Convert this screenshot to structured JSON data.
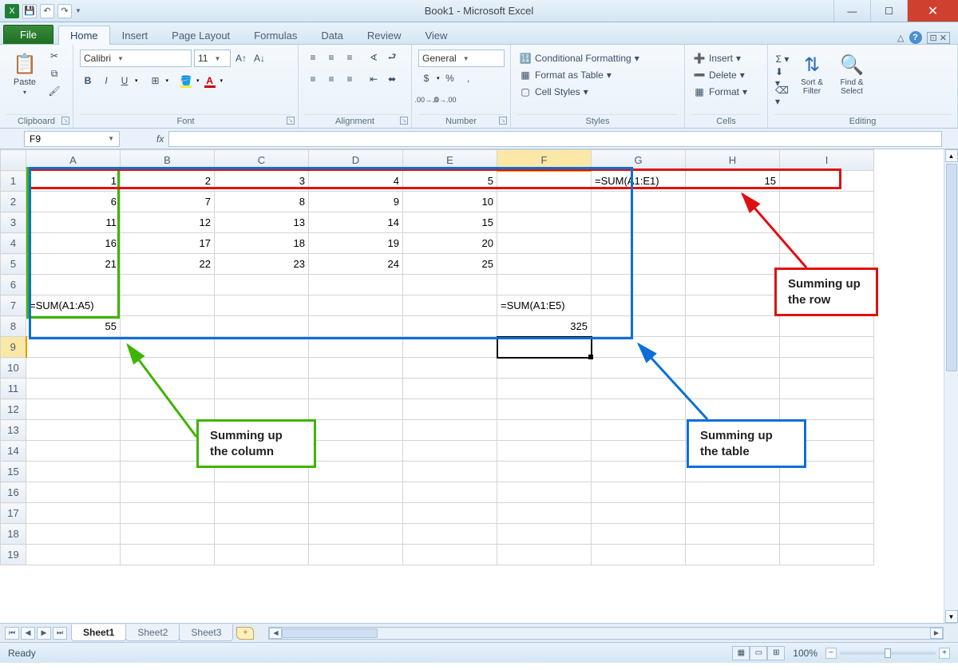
{
  "title": "Book1 - Microsoft Excel",
  "tabs": {
    "file": "File",
    "items": [
      "Home",
      "Insert",
      "Page Layout",
      "Formulas",
      "Data",
      "Review",
      "View"
    ],
    "active": "Home"
  },
  "ribbon": {
    "clipboard": {
      "label": "Clipboard",
      "paste": "Paste"
    },
    "font": {
      "label": "Font",
      "name": "Calibri",
      "size": "11"
    },
    "alignment": {
      "label": "Alignment"
    },
    "number": {
      "label": "Number",
      "format": "General"
    },
    "styles": {
      "label": "Styles",
      "cond": "Conditional Formatting",
      "table": "Format as Table",
      "cell": "Cell Styles"
    },
    "cells": {
      "label": "Cells",
      "insert": "Insert",
      "delete": "Delete",
      "format": "Format"
    },
    "editing": {
      "label": "Editing",
      "sort": "Sort & Filter",
      "find": "Find & Select"
    }
  },
  "namebox": "F9",
  "fx": "fx",
  "columns": [
    "A",
    "B",
    "C",
    "D",
    "E",
    "F",
    "G",
    "H",
    "I"
  ],
  "active_col": "F",
  "active_row": 9,
  "rows": 19,
  "cells": {
    "A1": {
      "v": "1",
      "t": "num"
    },
    "B1": {
      "v": "2",
      "t": "num"
    },
    "C1": {
      "v": "3",
      "t": "num"
    },
    "D1": {
      "v": "4",
      "t": "num"
    },
    "E1": {
      "v": "5",
      "t": "num"
    },
    "G1": {
      "v": "=SUM(A1:E1)",
      "t": "txt"
    },
    "H1": {
      "v": "15",
      "t": "num"
    },
    "A2": {
      "v": "6",
      "t": "num"
    },
    "B2": {
      "v": "7",
      "t": "num"
    },
    "C2": {
      "v": "8",
      "t": "num"
    },
    "D2": {
      "v": "9",
      "t": "num"
    },
    "E2": {
      "v": "10",
      "t": "num"
    },
    "A3": {
      "v": "11",
      "t": "num"
    },
    "B3": {
      "v": "12",
      "t": "num"
    },
    "C3": {
      "v": "13",
      "t": "num"
    },
    "D3": {
      "v": "14",
      "t": "num"
    },
    "E3": {
      "v": "15",
      "t": "num"
    },
    "A4": {
      "v": "16",
      "t": "num"
    },
    "B4": {
      "v": "17",
      "t": "num"
    },
    "C4": {
      "v": "18",
      "t": "num"
    },
    "D4": {
      "v": "19",
      "t": "num"
    },
    "E4": {
      "v": "20",
      "t": "num"
    },
    "A5": {
      "v": "21",
      "t": "num"
    },
    "B5": {
      "v": "22",
      "t": "num"
    },
    "C5": {
      "v": "23",
      "t": "num"
    },
    "D5": {
      "v": "24",
      "t": "num"
    },
    "E5": {
      "v": "25",
      "t": "num"
    },
    "A7": {
      "v": "=SUM(A1:A5)",
      "t": "txt"
    },
    "F7": {
      "v": "=SUM(A1:E5)",
      "t": "txt"
    },
    "A8": {
      "v": "55",
      "t": "num"
    },
    "F8": {
      "v": "325",
      "t": "num"
    }
  },
  "annotations": {
    "column": "Summing up the column",
    "table": "Summing up the table",
    "row": "Summing up the row"
  },
  "colors": {
    "green": "#3fb400",
    "blue": "#0d6fd6",
    "red": "#e01010"
  },
  "sheets": [
    "Sheet1",
    "Sheet2",
    "Sheet3"
  ],
  "active_sheet": "Sheet1",
  "status": "Ready",
  "zoom": "100%"
}
